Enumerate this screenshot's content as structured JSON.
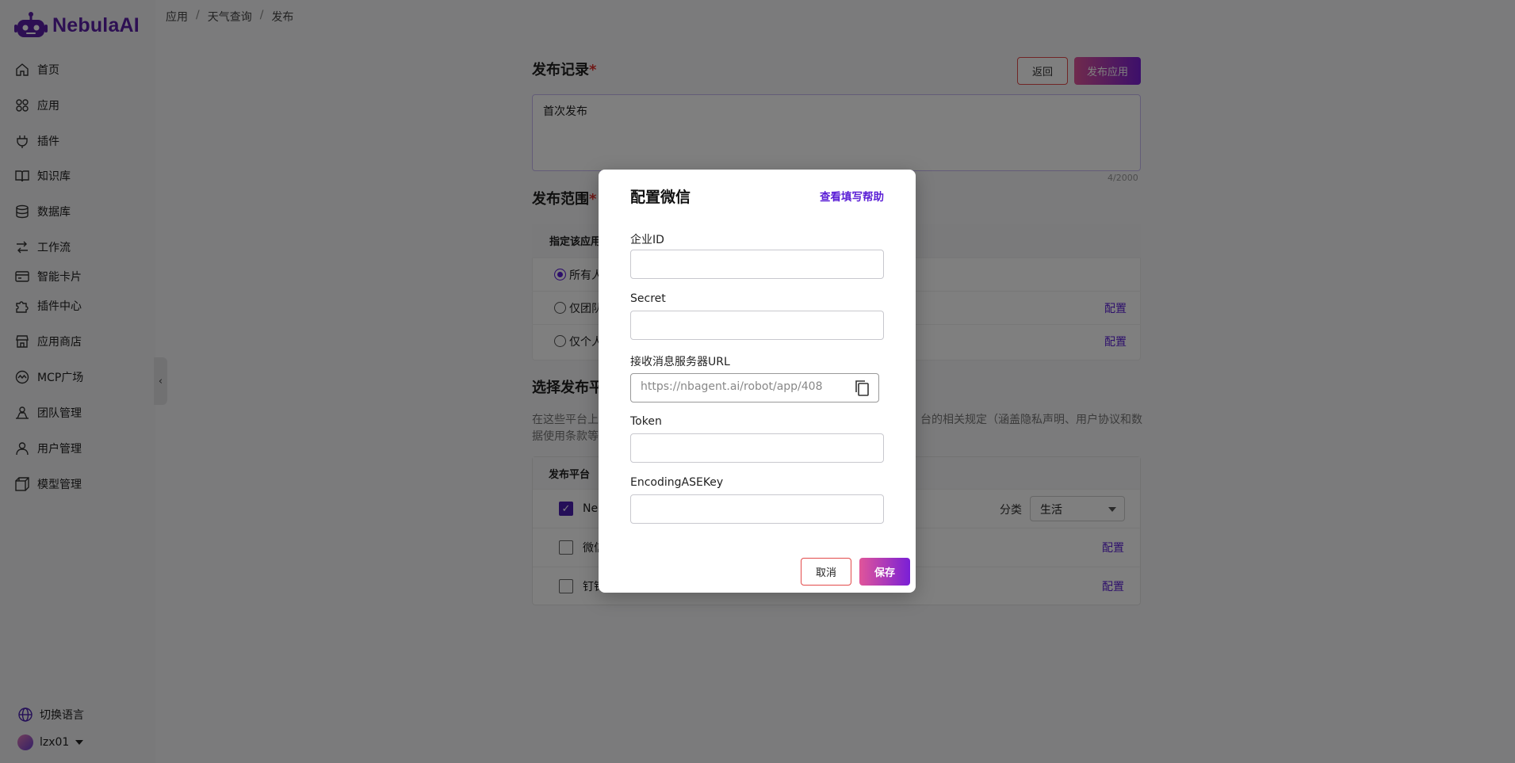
{
  "app": {
    "logo_text": "NebulaAI"
  },
  "sidebar": {
    "items": [
      {
        "label": "首页",
        "icon": "home-icon"
      },
      {
        "label": "应用",
        "icon": "apps-icon"
      },
      {
        "label": "插件",
        "icon": "plug-icon"
      },
      {
        "label": "知识库",
        "icon": "book-icon"
      },
      {
        "label": "数据库",
        "icon": "database-icon"
      },
      {
        "label": "工作流",
        "icon": "workflow-icon"
      },
      {
        "label": "智能卡片",
        "icon": "card-icon"
      },
      {
        "label": "插件中心",
        "icon": "puzzle-icon"
      },
      {
        "label": "应用商店",
        "icon": "store-icon"
      },
      {
        "label": "MCP广场",
        "icon": "mcp-icon"
      },
      {
        "label": "团队管理",
        "icon": "team-icon"
      },
      {
        "label": "用户管理",
        "icon": "user-icon"
      },
      {
        "label": "模型管理",
        "icon": "model-icon"
      }
    ],
    "language_label": "切换语言",
    "username": "lzx01",
    "collapse_glyph": "‹"
  },
  "breadcrumb": {
    "items": [
      "应用",
      "天气查询",
      "发布"
    ],
    "separator": "/"
  },
  "publish": {
    "record_title": "发布记录",
    "required_mark": "*",
    "back_label": "返回",
    "publish_label": "发布应用",
    "record_value": "首次发布",
    "counter": "4/2000",
    "scope_title": "发布范围",
    "scope_header": "指定该应用",
    "scope_options": [
      {
        "label": "所有人",
        "checked": true,
        "action": ""
      },
      {
        "label": "仅团队",
        "checked": false,
        "action": "配置"
      },
      {
        "label": "仅个人",
        "checked": false,
        "action": "配置"
      }
    ],
    "platform_title": "选择发布平",
    "desc_left": "在这些平台上",
    "desc_right": "台的相关规定（涵盖隐私声明、用户协议和数",
    "desc_line2": "据使用条款等",
    "platform_header": "发布平台",
    "platforms": [
      {
        "label": "Neb",
        "checked": true,
        "action": ""
      },
      {
        "label": "微信",
        "checked": false,
        "action": "配置"
      },
      {
        "label": "钉钉",
        "checked": false,
        "action": "配置"
      }
    ],
    "category_label": "分类",
    "category_value": "生活"
  },
  "modal": {
    "title": "配置微信",
    "help_link": "查看填写帮助",
    "fields": [
      {
        "label": "企业ID",
        "value": ""
      },
      {
        "label": "Secret",
        "value": ""
      },
      {
        "label": "Token",
        "value": ""
      },
      {
        "label": "EncodingASEKey",
        "value": ""
      }
    ],
    "url_label": "接收消息服务器URL",
    "url_value": "https://nbagent.ai/robot/app/408",
    "cancel_label": "取消",
    "save_label": "保存"
  },
  "colors": {
    "accent": "#5b1fd6",
    "brand": "#5b1fa6",
    "danger": "#e34a4a"
  }
}
